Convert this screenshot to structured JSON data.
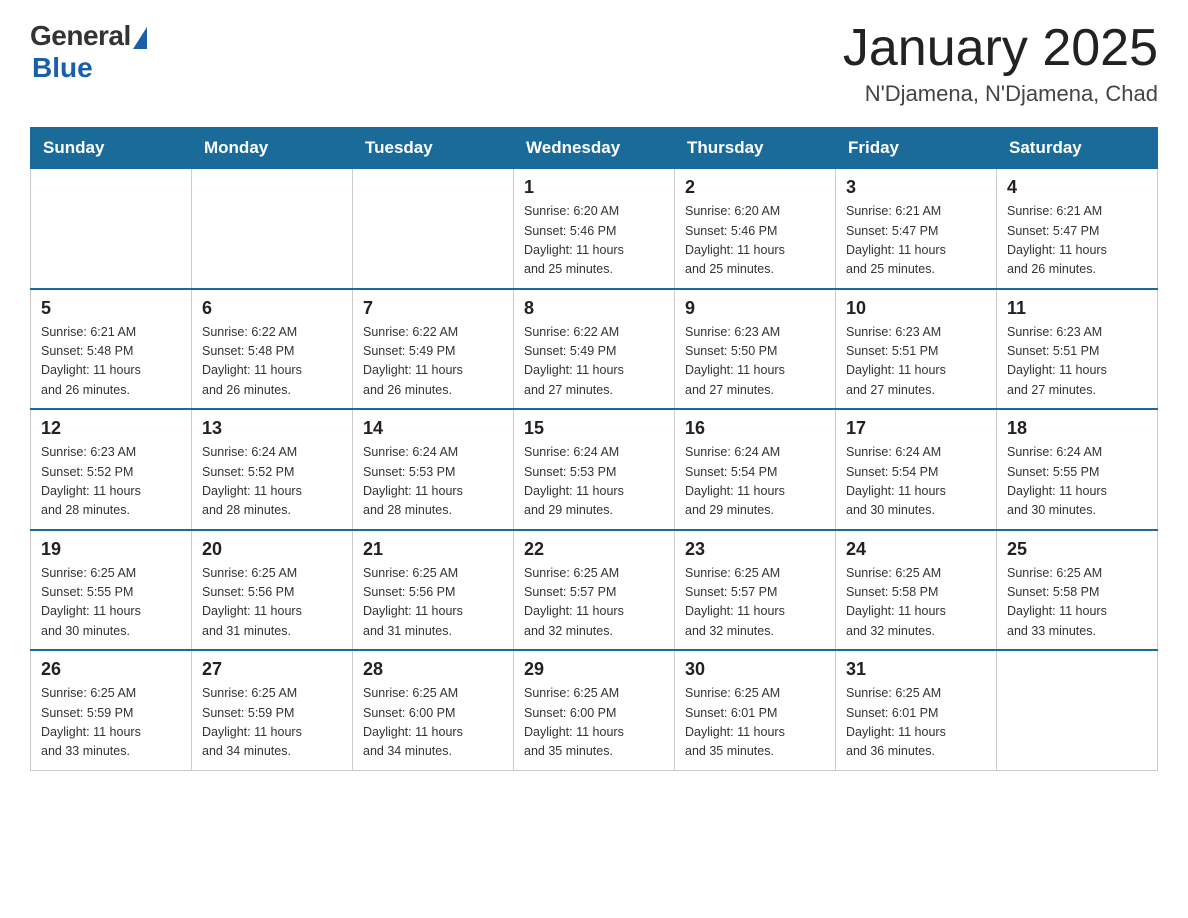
{
  "header": {
    "logo": {
      "general": "General",
      "blue": "Blue"
    },
    "title": "January 2025",
    "subtitle": "N'Djamena, N'Djamena, Chad"
  },
  "days_of_week": [
    "Sunday",
    "Monday",
    "Tuesday",
    "Wednesday",
    "Thursday",
    "Friday",
    "Saturday"
  ],
  "weeks": [
    [
      {
        "day": "",
        "info": ""
      },
      {
        "day": "",
        "info": ""
      },
      {
        "day": "",
        "info": ""
      },
      {
        "day": "1",
        "info": "Sunrise: 6:20 AM\nSunset: 5:46 PM\nDaylight: 11 hours\nand 25 minutes."
      },
      {
        "day": "2",
        "info": "Sunrise: 6:20 AM\nSunset: 5:46 PM\nDaylight: 11 hours\nand 25 minutes."
      },
      {
        "day": "3",
        "info": "Sunrise: 6:21 AM\nSunset: 5:47 PM\nDaylight: 11 hours\nand 25 minutes."
      },
      {
        "day": "4",
        "info": "Sunrise: 6:21 AM\nSunset: 5:47 PM\nDaylight: 11 hours\nand 26 minutes."
      }
    ],
    [
      {
        "day": "5",
        "info": "Sunrise: 6:21 AM\nSunset: 5:48 PM\nDaylight: 11 hours\nand 26 minutes."
      },
      {
        "day": "6",
        "info": "Sunrise: 6:22 AM\nSunset: 5:48 PM\nDaylight: 11 hours\nand 26 minutes."
      },
      {
        "day": "7",
        "info": "Sunrise: 6:22 AM\nSunset: 5:49 PM\nDaylight: 11 hours\nand 26 minutes."
      },
      {
        "day": "8",
        "info": "Sunrise: 6:22 AM\nSunset: 5:49 PM\nDaylight: 11 hours\nand 27 minutes."
      },
      {
        "day": "9",
        "info": "Sunrise: 6:23 AM\nSunset: 5:50 PM\nDaylight: 11 hours\nand 27 minutes."
      },
      {
        "day": "10",
        "info": "Sunrise: 6:23 AM\nSunset: 5:51 PM\nDaylight: 11 hours\nand 27 minutes."
      },
      {
        "day": "11",
        "info": "Sunrise: 6:23 AM\nSunset: 5:51 PM\nDaylight: 11 hours\nand 27 minutes."
      }
    ],
    [
      {
        "day": "12",
        "info": "Sunrise: 6:23 AM\nSunset: 5:52 PM\nDaylight: 11 hours\nand 28 minutes."
      },
      {
        "day": "13",
        "info": "Sunrise: 6:24 AM\nSunset: 5:52 PM\nDaylight: 11 hours\nand 28 minutes."
      },
      {
        "day": "14",
        "info": "Sunrise: 6:24 AM\nSunset: 5:53 PM\nDaylight: 11 hours\nand 28 minutes."
      },
      {
        "day": "15",
        "info": "Sunrise: 6:24 AM\nSunset: 5:53 PM\nDaylight: 11 hours\nand 29 minutes."
      },
      {
        "day": "16",
        "info": "Sunrise: 6:24 AM\nSunset: 5:54 PM\nDaylight: 11 hours\nand 29 minutes."
      },
      {
        "day": "17",
        "info": "Sunrise: 6:24 AM\nSunset: 5:54 PM\nDaylight: 11 hours\nand 30 minutes."
      },
      {
        "day": "18",
        "info": "Sunrise: 6:24 AM\nSunset: 5:55 PM\nDaylight: 11 hours\nand 30 minutes."
      }
    ],
    [
      {
        "day": "19",
        "info": "Sunrise: 6:25 AM\nSunset: 5:55 PM\nDaylight: 11 hours\nand 30 minutes."
      },
      {
        "day": "20",
        "info": "Sunrise: 6:25 AM\nSunset: 5:56 PM\nDaylight: 11 hours\nand 31 minutes."
      },
      {
        "day": "21",
        "info": "Sunrise: 6:25 AM\nSunset: 5:56 PM\nDaylight: 11 hours\nand 31 minutes."
      },
      {
        "day": "22",
        "info": "Sunrise: 6:25 AM\nSunset: 5:57 PM\nDaylight: 11 hours\nand 32 minutes."
      },
      {
        "day": "23",
        "info": "Sunrise: 6:25 AM\nSunset: 5:57 PM\nDaylight: 11 hours\nand 32 minutes."
      },
      {
        "day": "24",
        "info": "Sunrise: 6:25 AM\nSunset: 5:58 PM\nDaylight: 11 hours\nand 32 minutes."
      },
      {
        "day": "25",
        "info": "Sunrise: 6:25 AM\nSunset: 5:58 PM\nDaylight: 11 hours\nand 33 minutes."
      }
    ],
    [
      {
        "day": "26",
        "info": "Sunrise: 6:25 AM\nSunset: 5:59 PM\nDaylight: 11 hours\nand 33 minutes."
      },
      {
        "day": "27",
        "info": "Sunrise: 6:25 AM\nSunset: 5:59 PM\nDaylight: 11 hours\nand 34 minutes."
      },
      {
        "day": "28",
        "info": "Sunrise: 6:25 AM\nSunset: 6:00 PM\nDaylight: 11 hours\nand 34 minutes."
      },
      {
        "day": "29",
        "info": "Sunrise: 6:25 AM\nSunset: 6:00 PM\nDaylight: 11 hours\nand 35 minutes."
      },
      {
        "day": "30",
        "info": "Sunrise: 6:25 AM\nSunset: 6:01 PM\nDaylight: 11 hours\nand 35 minutes."
      },
      {
        "day": "31",
        "info": "Sunrise: 6:25 AM\nSunset: 6:01 PM\nDaylight: 11 hours\nand 36 minutes."
      },
      {
        "day": "",
        "info": ""
      }
    ]
  ]
}
